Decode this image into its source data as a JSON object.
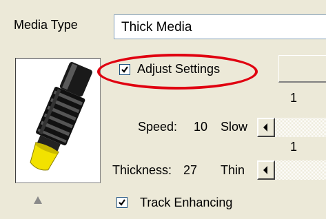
{
  "media_type": {
    "label": "Media Type",
    "value": "Thick Media"
  },
  "adjust_settings": {
    "label": "Adjust Settings",
    "checked": true
  },
  "speed": {
    "label": "Speed:",
    "value": "10",
    "min_label": "Slow",
    "scale_mark": "1"
  },
  "thickness": {
    "label": "Thickness:",
    "value": "27",
    "min_label": "Thin",
    "scale_mark": "1"
  },
  "track_enhancing": {
    "label": "Track Enhancing",
    "checked": true
  },
  "colors": {
    "highlight": "#e00010",
    "panel": "#ece9d8",
    "nozzle_tip": "#f2e200"
  }
}
